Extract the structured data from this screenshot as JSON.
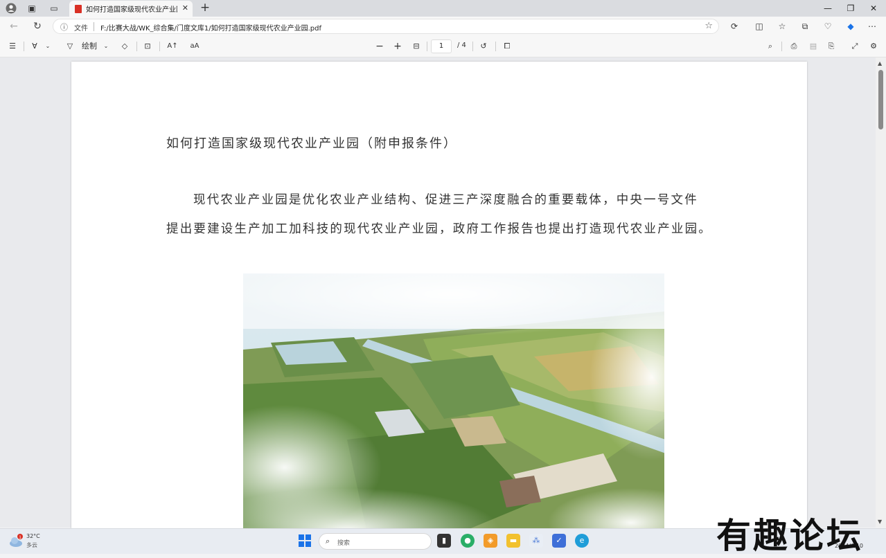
{
  "browser": {
    "tab_title": "如何打造国家级现代农业产业园.pdf",
    "new_tab": "+",
    "file_label": "文件",
    "url": "F:/比赛大战/WK_综合集/门度文库1/如何打造国家级现代农业产业园.pdf",
    "window_controls": [
      "—",
      "❐",
      "✕"
    ]
  },
  "pdf_toolbar": {
    "draw_label": "绘制",
    "zoom_out": "−",
    "zoom_in": "+",
    "current_page": "1",
    "total_pages": "/ 4"
  },
  "document": {
    "title": "如何打造国家级现代农业产业园（附申报条件）",
    "paragraph_line1": "现代农业产业园是优化农业产业结构、促进三产深度融合的重要载体，中央一号文件",
    "paragraph_line2": "提出要建设生产加工加科技的现代农业产业园，政府工作报告也提出打造现代农业产业园。"
  },
  "taskbar": {
    "weather_temp": "32°C",
    "weather_desc": "多云",
    "weather_badge": "1",
    "search_placeholder": "搜索",
    "clock_date": "2024/6/10"
  },
  "watermark": "有趣论坛",
  "colors": {
    "tab_strip": "#dadce0",
    "toolbar": "#f7f7f7",
    "viewer_bg": "#e9eaed",
    "edge_blue": "#1a73e8"
  }
}
